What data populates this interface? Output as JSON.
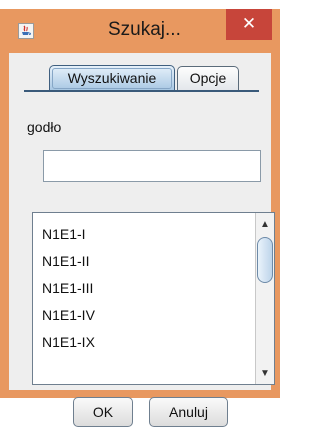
{
  "window": {
    "title": "Szukaj...",
    "close_glyph": "✕",
    "app_icon": "java-icon"
  },
  "tabs": [
    {
      "label": "Wyszukiwanie",
      "active": true
    },
    {
      "label": "Opcje",
      "active": false
    }
  ],
  "search": {
    "label": "godło",
    "value": ""
  },
  "results": {
    "items": [
      "N1E1-I",
      "N1E1-II",
      "N1E1-III",
      "N1E1-IV",
      "N1E1-IX"
    ],
    "scroll_up_glyph": "▲",
    "scroll_down_glyph": "▼"
  },
  "buttons": {
    "ok_label": "OK",
    "cancel_label": "Anuluj"
  },
  "colors": {
    "frame": "#e89860",
    "close": "#c7453a",
    "active_tab": "#a9c8e4"
  }
}
